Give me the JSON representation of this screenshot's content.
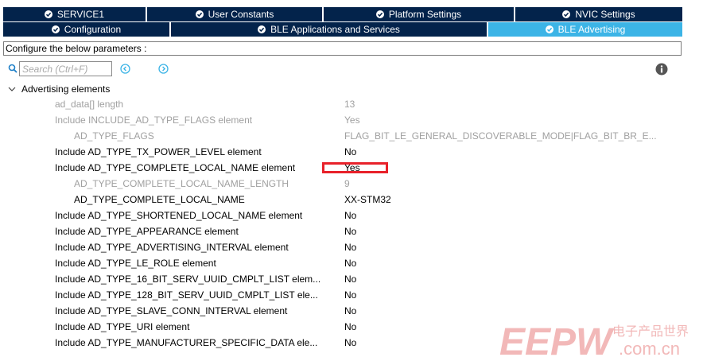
{
  "tabs_row1": [
    {
      "label": "SERVICE1"
    },
    {
      "label": "User Constants"
    },
    {
      "label": "Platform Settings"
    },
    {
      "label": "NVIC Settings"
    }
  ],
  "tabs_row2": [
    {
      "label": "Configuration"
    },
    {
      "label": "BLE Applications and Services"
    },
    {
      "label": "BLE Advertising",
      "active": true
    }
  ],
  "config_text": "Configure the below parameters :",
  "search": {
    "placeholder": "Search (Ctrl+F)"
  },
  "section": {
    "label": "Advertising elements"
  },
  "rows": [
    {
      "label": "ad_data[] length",
      "value": "13",
      "disabled": true,
      "indent": 1
    },
    {
      "label": "Include INCLUDE_AD_TYPE_FLAGS element",
      "value": "Yes",
      "disabled": true,
      "indent": 1
    },
    {
      "label": "AD_TYPE_FLAGS",
      "value": "FLAG_BIT_LE_GENERAL_DISCOVERABLE_MODE|FLAG_BIT_BR_E...",
      "disabled": true,
      "indent": 2
    },
    {
      "label": "Include AD_TYPE_TX_POWER_LEVEL element",
      "value": "No",
      "disabled": false,
      "indent": 1
    },
    {
      "label": "Include AD_TYPE_COMPLETE_LOCAL_NAME element",
      "value": "Yes",
      "disabled": false,
      "indent": 1,
      "highlighted": true
    },
    {
      "label": "AD_TYPE_COMPLETE_LOCAL_NAME_LENGTH",
      "value": "9",
      "disabled": true,
      "indent": 2
    },
    {
      "label": "AD_TYPE_COMPLETE_LOCAL_NAME",
      "value": "XX-STM32",
      "disabled": false,
      "indent": 2
    },
    {
      "label": "Include AD_TYPE_SHORTENED_LOCAL_NAME  element",
      "value": "No",
      "disabled": false,
      "indent": 1
    },
    {
      "label": "Include AD_TYPE_APPEARANCE element",
      "value": "No",
      "disabled": false,
      "indent": 1
    },
    {
      "label": "Include AD_TYPE_ADVERTISING_INTERVAL element",
      "value": "No",
      "disabled": false,
      "indent": 1
    },
    {
      "label": "Include AD_TYPE_LE_ROLE element",
      "value": "No",
      "disabled": false,
      "indent": 1
    },
    {
      "label": "Include AD_TYPE_16_BIT_SERV_UUID_CMPLT_LIST elem...",
      "value": "No",
      "disabled": false,
      "indent": 1
    },
    {
      "label": "Include AD_TYPE_128_BIT_SERV_UUID_CMPLT_LIST ele...",
      "value": "No",
      "disabled": false,
      "indent": 1
    },
    {
      "label": "Include AD_TYPE_SLAVE_CONN_INTERVAL element",
      "value": "No",
      "disabled": false,
      "indent": 1
    },
    {
      "label": "Include AD_TYPE_URI element",
      "value": "No",
      "disabled": false,
      "indent": 1
    },
    {
      "label": "Include AD_TYPE_MANUFACTURER_SPECIFIC_DATA ele...",
      "value": "No",
      "disabled": false,
      "indent": 1
    }
  ],
  "watermark": {
    "brand": "EEPW",
    "site": ".com.cn",
    "cn": "电子产品世界"
  },
  "colors": {
    "tab_bg": "#03234b",
    "tab_active": "#3cb4e6",
    "highlight": "#e8212a",
    "disabled_text": "#a0a0a0",
    "nav_icon": "#3cb4e6",
    "watermark": "#f2b8b8"
  }
}
